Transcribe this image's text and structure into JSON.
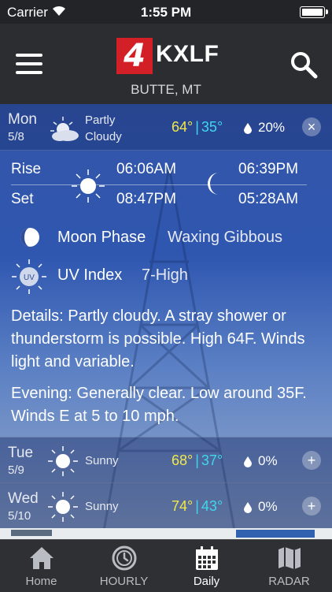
{
  "status_bar": {
    "carrier": "Carrier",
    "time": "1:55 PM"
  },
  "header": {
    "logo_number": "4",
    "logo_call_letters": "KXLF",
    "location": "BUTTE, MT"
  },
  "today": {
    "day": "Mon",
    "date": "5/8",
    "condition_line1": "Partly",
    "condition_line2": "Cloudy",
    "high": "64°",
    "low": "35°",
    "separator": "|",
    "precip": "20%",
    "icon": "partly-cloudy-icon",
    "action": "×",
    "sun_rise_label": "Rise",
    "sun_set_label": "Set",
    "sunrise": "06:06AM",
    "sunset": "08:47PM",
    "moonrise": "06:39PM",
    "moonset": "05:28AM",
    "moon_phase_label": "Moon Phase",
    "moon_phase_value": "Waxing Gibbous",
    "uv_badge": "UV",
    "uv_label": "UV Index",
    "uv_value": "7-High",
    "details": "Details: Partly cloudy. A stray shower or thunderstorm is possible. High 64F. Winds light and variable.",
    "evening": "Evening: Generally clear. Low around 35F. Winds E at 5 to 10 mph."
  },
  "forecast": [
    {
      "day": "Tue",
      "date": "5/9",
      "condition": "Sunny",
      "high": "68°",
      "low": "37°",
      "separator": "|",
      "precip": "0%",
      "action": "+",
      "icon": "sunny-icon"
    },
    {
      "day": "Wed",
      "date": "5/10",
      "condition": "Sunny",
      "high": "74°",
      "low": "43°",
      "separator": "|",
      "precip": "0%",
      "action": "+",
      "icon": "sunny-icon"
    }
  ],
  "tabs": [
    {
      "label": "Home",
      "icon": "home-icon"
    },
    {
      "label": "HOURLY",
      "icon": "clock-icon"
    },
    {
      "label": "Daily",
      "icon": "calendar-icon",
      "active": true
    },
    {
      "label": "RADAR",
      "icon": "map-icon"
    }
  ],
  "colors": {
    "high": "#f3e84a",
    "low": "#3fd7ec",
    "header": "#2b2d31",
    "logo_red": "#d31f26"
  }
}
